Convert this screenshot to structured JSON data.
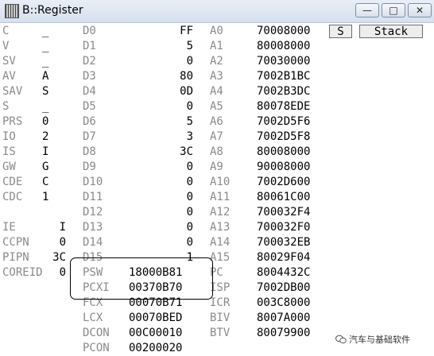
{
  "window": {
    "title": "B::Register",
    "minimize_label": "—",
    "maximize_label": "□",
    "close_label": "✕"
  },
  "buttons": {
    "s_label": "S",
    "stack_label": "Stack"
  },
  "flags": [
    {
      "name": "C",
      "value": "_"
    },
    {
      "name": "V",
      "value": "_"
    },
    {
      "name": "SV",
      "value": "_"
    },
    {
      "name": "AV",
      "value": "A"
    },
    {
      "name": "SAV",
      "value": "S"
    },
    {
      "name": "S",
      "value": "_"
    },
    {
      "name": "PRS",
      "value": "0"
    },
    {
      "name": "IO",
      "value": "2"
    },
    {
      "name": "IS",
      "value": "I"
    },
    {
      "name": "GW",
      "value": "G"
    },
    {
      "name": "CDE",
      "value": "C"
    },
    {
      "name": "CDC",
      "value": "1"
    }
  ],
  "interrupt": [
    {
      "name": "IE",
      "value": "I"
    },
    {
      "name": "CCPN",
      "value": "0"
    },
    {
      "name": "PIPN",
      "value": "3C"
    },
    {
      "name": "COREID",
      "value": "0"
    }
  ],
  "data_regs": [
    {
      "name": "D0",
      "value": "FF"
    },
    {
      "name": "D1",
      "value": "5"
    },
    {
      "name": "D2",
      "value": "0"
    },
    {
      "name": "D3",
      "value": "80"
    },
    {
      "name": "D4",
      "value": "0D"
    },
    {
      "name": "D5",
      "value": "0"
    },
    {
      "name": "D6",
      "value": "5"
    },
    {
      "name": "D7",
      "value": "3"
    },
    {
      "name": "D8",
      "value": "3C"
    },
    {
      "name": "D9",
      "value": "0"
    },
    {
      "name": "D10",
      "value": "0"
    },
    {
      "name": "D11",
      "value": "0"
    },
    {
      "name": "D12",
      "value": "0"
    },
    {
      "name": "D13",
      "value": "0"
    },
    {
      "name": "D14",
      "value": "0"
    },
    {
      "name": "D15",
      "value": "1"
    }
  ],
  "addr_regs": [
    {
      "name": "A0",
      "value": "70008000"
    },
    {
      "name": "A1",
      "value": "80008000"
    },
    {
      "name": "A2",
      "value": "70030000"
    },
    {
      "name": "A3",
      "value": "7002B1BC"
    },
    {
      "name": "A4",
      "value": "7002B3DC"
    },
    {
      "name": "A5",
      "value": "80078EDE"
    },
    {
      "name": "A6",
      "value": "7002D5F6"
    },
    {
      "name": "A7",
      "value": "7002D5F8"
    },
    {
      "name": "A8",
      "value": "80008000"
    },
    {
      "name": "A9",
      "value": "90008000"
    },
    {
      "name": "A10",
      "value": "7002D600"
    },
    {
      "name": "A11",
      "value": "80061C00"
    },
    {
      "name": "A12",
      "value": "700032F4"
    },
    {
      "name": "A13",
      "value": "700032F0"
    },
    {
      "name": "A14",
      "value": "700032EB"
    },
    {
      "name": "A15",
      "value": "80029F04"
    }
  ],
  "sys_regs": [
    {
      "name": "PSW",
      "value": "18000B81",
      "name2": "PC",
      "value2": "8004432C"
    },
    {
      "name": "PCXI",
      "value": "00370B70",
      "name2": "ISP",
      "value2": "7002DB00"
    },
    {
      "name": "FCX",
      "value": "00070B71",
      "name2": "ICR",
      "value2": "003C8000"
    },
    {
      "name": "LCX",
      "value": "00070BED",
      "name2": "BIV",
      "value2": "8007A000"
    },
    {
      "name": "DCON",
      "value": "00C00010",
      "name2": "BTV",
      "value2": "80079900"
    },
    {
      "name": "PCON",
      "value": "00200020",
      "name2": "",
      "value2": ""
    }
  ],
  "watermark": "汽车与基础软件"
}
